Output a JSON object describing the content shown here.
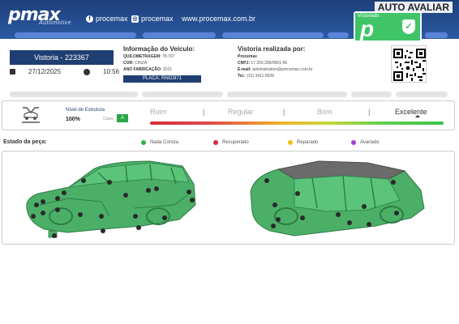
{
  "header": {
    "logo": "pmax",
    "logo_sub": "Automotive",
    "facebook": "procemax",
    "instagram": "procemax",
    "website": "www.procemax.com.br",
    "partner_brand": "AUTO AVALIAR",
    "seal_label": "Vistoriado",
    "seal_letter": "p"
  },
  "vistoria": {
    "title": "Vistoria - 223367",
    "date": "27/12/2025",
    "time": "10:56"
  },
  "vehicle": {
    "heading": "Informação do Veículo:",
    "odometer_label": "QUILOMETRAGEM:",
    "odometer": "78.707",
    "color_label": "COR:",
    "color": "CINZA",
    "year_label": "ANO FABRICAÇÃO:",
    "year": "2021",
    "plate": "PLACA: RNO3I71"
  },
  "inspector": {
    "heading": "Vistoria realizada por:",
    "name": "Procemax",
    "cnpj_label": "CNPJ:",
    "cnpj": "17.209.289/0001-56",
    "email_label": "E-mail:",
    "email": "administrativo@procemax.com.br",
    "phone_label": "Tel.:",
    "phone": "(31) 3411-5826"
  },
  "structure": {
    "level_label": "Nível de Estrutura",
    "level_value": "100%",
    "class_label": "Class.",
    "class_value": "A",
    "scale": [
      "Ruim",
      "Regular",
      "Bom",
      "Excelente"
    ],
    "selected": "Excelente"
  },
  "legend": {
    "title": "Estado da peça:",
    "items": [
      {
        "label": "Nada Consta",
        "color": "#2fb34a"
      },
      {
        "label": "Recuperado",
        "color": "#d62b3a"
      },
      {
        "label": "Reparado",
        "color": "#f2c014"
      },
      {
        "label": "Avariado",
        "color": "#a63ad6"
      }
    ]
  },
  "colors": {
    "car_body": "#4caf68",
    "car_dark": "#2e7d45"
  }
}
